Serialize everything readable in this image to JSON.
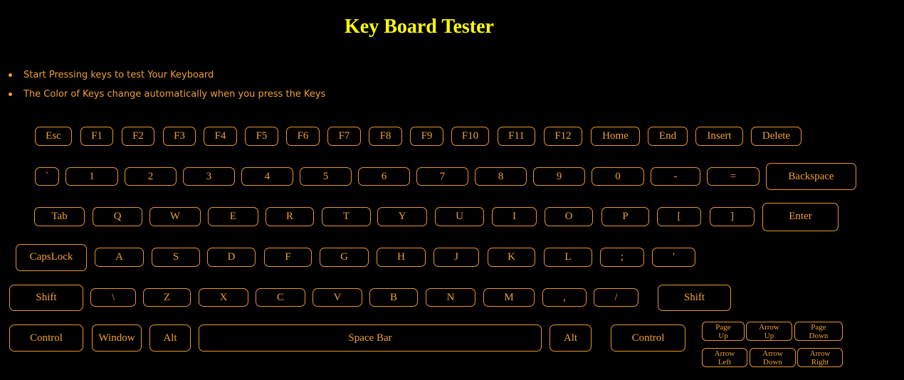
{
  "page": {
    "title": "Key Board Tester",
    "instructions": [
      "Start Pressing keys to test Your Keyboard",
      "The Color of Keys change automatically when you press the Keys"
    ]
  },
  "colors": {
    "background": "#000000",
    "title": "#ffff00",
    "key_border": "#e8962a",
    "key_text": "#f0a030"
  },
  "keyboard": {
    "rows": [
      [
        "Esc",
        "F1",
        "F2",
        "F3",
        "F4",
        "F5",
        "F6",
        "F7",
        "F8",
        "F9",
        "F10",
        "F11",
        "F12",
        "Home",
        "End",
        "Insert",
        "Delete"
      ],
      [
        "`",
        "1",
        "2",
        "3",
        "4",
        "5",
        "6",
        "7",
        "8",
        "9",
        "0",
        "-",
        "=",
        "Backspace"
      ],
      [
        "Tab",
        "Q",
        "W",
        "E",
        "R",
        "T",
        "Y",
        "U",
        "I",
        "O",
        "P",
        "[",
        "]",
        "Enter"
      ],
      [
        "CapsLock",
        "A",
        "S",
        "D",
        "F",
        "G",
        "H",
        "J",
        "K",
        "L",
        ";",
        "'"
      ],
      [
        "Shift",
        "\\",
        "Z",
        "X",
        "C",
        "V",
        "B",
        "N",
        "M",
        ",",
        "/",
        "Shift"
      ],
      [
        "Control",
        "Window",
        "Alt",
        "Space Bar",
        "Alt",
        "Control"
      ]
    ],
    "nav_keys": [
      [
        "Page\nUp",
        "Arrow\nUp",
        "Page\nDown"
      ],
      [
        "Arrow\nLeft",
        "Arrow\nDown",
        "Arrow\nRight"
      ]
    ]
  }
}
